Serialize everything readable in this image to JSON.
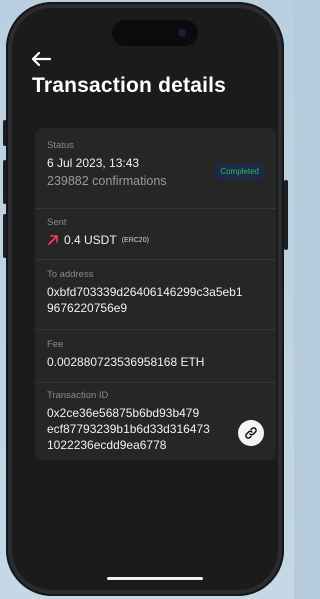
{
  "header": {
    "title": "Transaction details"
  },
  "status": {
    "label": "Status",
    "date": "6 Jul 2023, 13:43",
    "confirmations": "239882 confirmations",
    "badge": "Completed",
    "badge_color": "#2fbf5b"
  },
  "sent": {
    "label": "Sent",
    "amount": "0.4 USDT",
    "token_standard": "(ERC20)",
    "icon": "arrow-up-right-icon",
    "icon_color": "#ff3b5c"
  },
  "to_address": {
    "label": "To address",
    "line1": "0xbfd703339d26406146299c3a5eb1",
    "line2": "9676220756e9"
  },
  "fee": {
    "label": "Fee",
    "value": "0.002880723536958168 ETH"
  },
  "transaction_id": {
    "label": "Transaction ID",
    "line1": "0x2ce36e56875b6bd93b479",
    "line2": "ecf87793239b1b6d33d316473",
    "line3": "1022236ecdd9ea6778",
    "action_icon": "link-icon"
  }
}
